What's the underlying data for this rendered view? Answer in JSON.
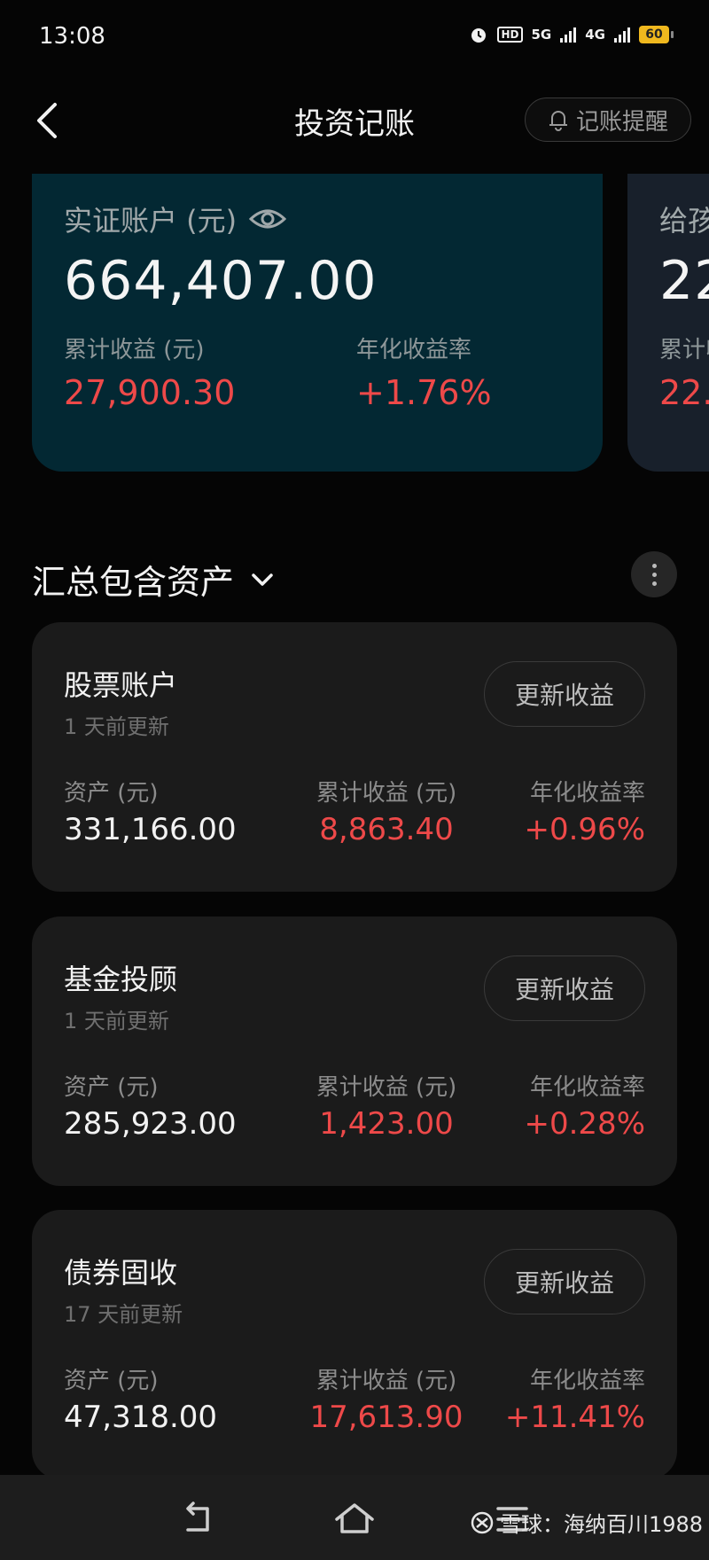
{
  "status_bar": {
    "time": "13:08",
    "hd": "HD",
    "net1": "5G",
    "net2": "4G",
    "battery": "60"
  },
  "header": {
    "title": "投资记账",
    "remind_label": "记账提醒"
  },
  "account_card": {
    "label": "实证账户 (元)",
    "total": "664,407.00",
    "cum_label": "累计收益 (元)",
    "cum_value": "27,900.30",
    "rate_label": "年化收益率",
    "rate_value": "+1.76%"
  },
  "account_card2": {
    "label": "给孩",
    "total": "22",
    "cum_label": "累计收",
    "cum_value": "22."
  },
  "section": {
    "title": "汇总包含资产"
  },
  "assets": [
    {
      "name": "股票账户",
      "updated": "1 天前更新",
      "button": "更新收益",
      "asset_label": "资产 (元)",
      "asset_value": "331,166.00",
      "cum_label": "累计收益 (元)",
      "cum_value": "8,863.40",
      "rate_label": "年化收益率",
      "rate_value": "+0.96%"
    },
    {
      "name": "基金投顾",
      "updated": "1 天前更新",
      "button": "更新收益",
      "asset_label": "资产 (元)",
      "asset_value": "285,923.00",
      "cum_label": "累计收益 (元)",
      "cum_value": "1,423.00",
      "rate_label": "年化收益率",
      "rate_value": "+0.28%"
    },
    {
      "name": "债券固收",
      "updated": "17 天前更新",
      "button": "更新收益",
      "asset_label": "资产 (元)",
      "asset_value": "47,318.00",
      "cum_label": "累计收益 (元)",
      "cum_value": "17,613.90",
      "rate_label": "年化收益率",
      "rate_value": "+11.41%"
    }
  ],
  "watermark": "雪球：海纳百川1988",
  "colors": {
    "background": "#050505",
    "account_card": "#032833",
    "card": "#1b1b1b",
    "gain_red": "#ee4949",
    "battery": "#f0b81e"
  },
  "icons": [
    "alarm-icon",
    "eye-icon",
    "bell-icon",
    "chevron-down-icon",
    "more-icon",
    "back-nav-icon",
    "home-icon",
    "menu-icon",
    "xueqiu-logo-icon"
  ]
}
